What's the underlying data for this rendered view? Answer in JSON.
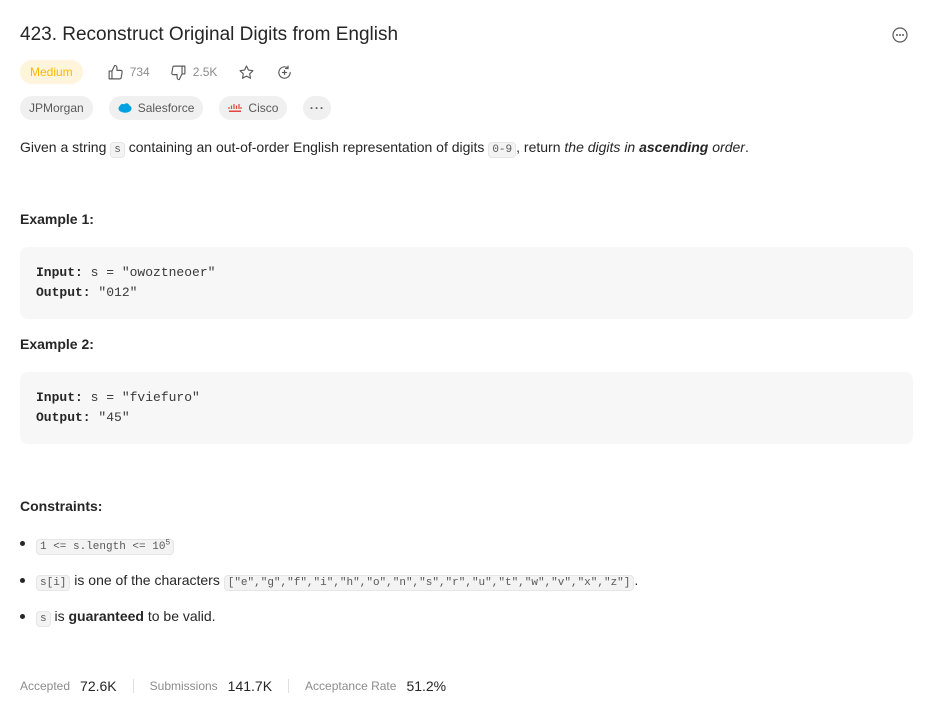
{
  "problem": {
    "title": "423. Reconstruct Original Digits from English",
    "difficulty": "Medium",
    "likes": "734",
    "dislikes": "2.5K"
  },
  "tags": [
    {
      "label": "JPMorgan",
      "icon": "none"
    },
    {
      "label": "Salesforce",
      "icon": "salesforce-icon"
    },
    {
      "label": "Cisco",
      "icon": "cisco-icon"
    }
  ],
  "more_tags_label": "···",
  "description": {
    "p1": "Given a string ",
    "code_s": "s",
    "p2": " containing an out-of-order English representation of digits ",
    "code_range": "0-9",
    "p3": ", return ",
    "em1": "the digits in ",
    "strong_em": "ascending",
    "em2": " order",
    "p4": "."
  },
  "examples": [
    {
      "title": "Example 1:",
      "input_label": "Input:",
      "input_value": " s = \"owoztneoer\"",
      "output_label": "Output:",
      "output_value": " \"012\""
    },
    {
      "title": "Example 2:",
      "input_label": "Input:",
      "input_value": " s = \"fviefuro\"",
      "output_label": "Output:",
      "output_value": " \"45\""
    }
  ],
  "constraints": {
    "title": "Constraints:",
    "c1_code": "1 <= s.length <= 10",
    "c1_sup": "5",
    "c2_code": "s[i]",
    "c2_text": " is one of the characters ",
    "c2_chars": "[\"e\",\"g\",\"f\",\"i\",\"h\",\"o\",\"n\",\"s\",\"r\",\"u\",\"t\",\"w\",\"v\",\"x\",\"z\"]",
    "c2_end": ".",
    "c3_code": "s",
    "c3_text1": " is ",
    "c3_strong": "guaranteed",
    "c3_text2": " to be valid."
  },
  "footer": {
    "accepted_label": "Accepted",
    "accepted_value": "72.6K",
    "submissions_label": "Submissions",
    "submissions_value": "141.7K",
    "rate_label": "Acceptance Rate",
    "rate_value": "51.2%"
  },
  "colors": {
    "medium": "#ffb800",
    "salesforce": "#00a1e0",
    "cisco": "#e0463e"
  }
}
